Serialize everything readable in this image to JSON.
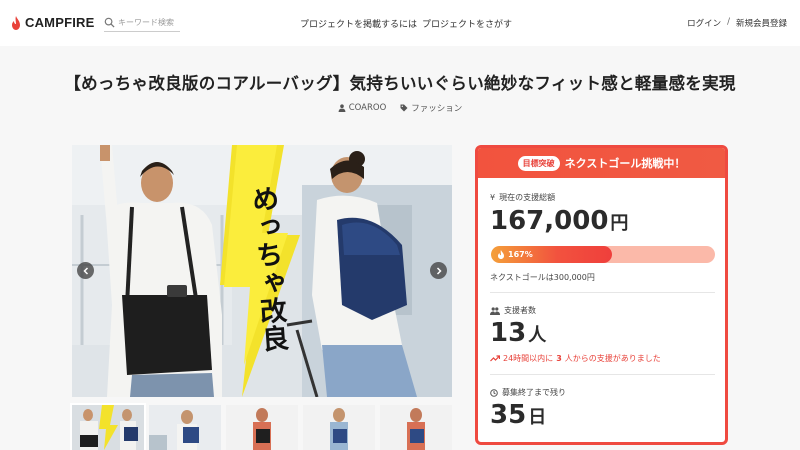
{
  "header": {
    "brand": "CAMPFIRE",
    "search_placeholder": "キーワード検索",
    "nav": [
      "プロジェクトを掲載するには",
      "プロジェクトをさがす"
    ],
    "login": "ログイン",
    "separator": "/",
    "signup": "新規会員登録"
  },
  "project": {
    "title": "【めっちゃ改良版のコアルーバッグ】気持ちいいぐらい絶妙なフィット感と軽量感を実現",
    "owner": "COAROO",
    "category": "ファッション",
    "hero_overlay_text": "めっちゃ改良"
  },
  "card": {
    "badge": "目標突破",
    "headline": "ネクストゴール挑戦中！",
    "amount_label": "現在の支援総額",
    "amount_value": "167,000",
    "amount_unit": "円",
    "progress_label": "167%",
    "progress_fraction": 0.54,
    "next_goal": "ネクストゴールは300,000円",
    "supporters_label": "支援者数",
    "supporters_value": "13",
    "supporters_unit": "人",
    "trend_prefix": "24時間以内に",
    "trend_count": "3",
    "trend_suffix": "人からの支援がありました",
    "remaining_label": "募集終了まで残り",
    "remaining_value": "35",
    "remaining_unit": "日"
  },
  "colors": {
    "accent": "#ef4a40",
    "progress_track": "#fbb9a9"
  },
  "icons": {
    "logo": "flame-icon",
    "search": "search-icon",
    "owner": "user-icon",
    "category": "tag-icon",
    "amount": "yen-icon",
    "supporters": "users-icon",
    "trend": "trending-up-icon",
    "remaining": "clock-icon",
    "progress": "flame-icon"
  }
}
